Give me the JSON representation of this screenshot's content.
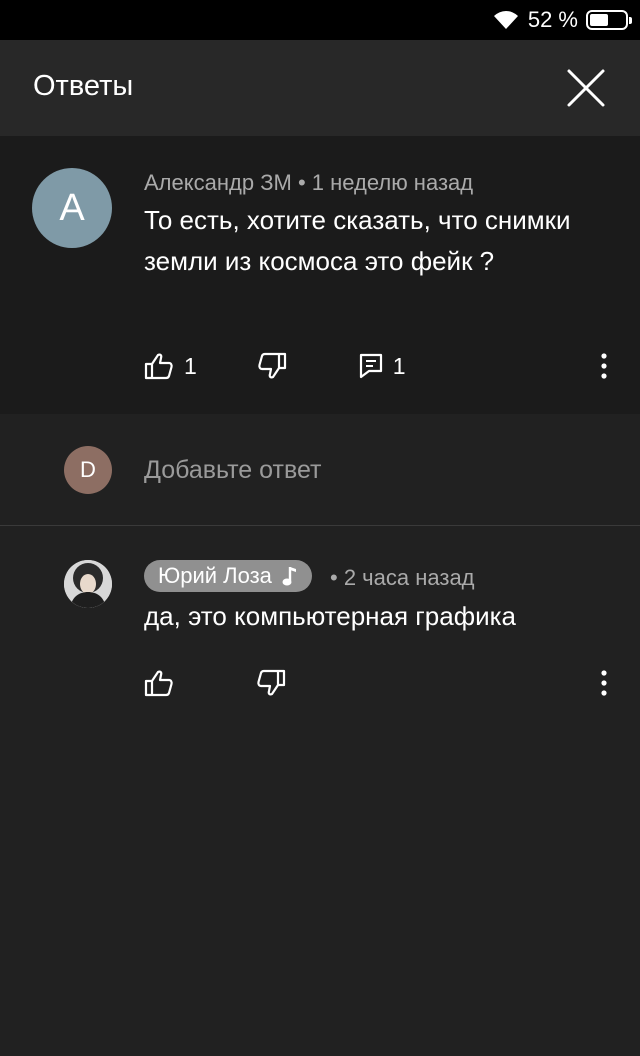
{
  "status_bar": {
    "battery_percent_text": "52 %",
    "battery_level": 0.52,
    "wifi_icon": "wifi-icon"
  },
  "header": {
    "title": "Ответы",
    "close_icon": "close-icon"
  },
  "comment": {
    "avatar_letter": "A",
    "avatar_color": "#7f9aa7",
    "author": "Александр ЗМ",
    "separator": "•",
    "time": "1 неделю назад",
    "text": "То есть, хотите сказать, что снимки земли из космоса это фейк ?",
    "likes": "1",
    "replies": "1"
  },
  "add_reply": {
    "avatar_letter": "D",
    "avatar_color": "#8d6e63",
    "placeholder": "Добавьте ответ"
  },
  "reply": {
    "author": "Юрий Лоза",
    "author_badge_icon": "music-note-icon",
    "separator": "•",
    "time": "2 часа назад",
    "text": "да, это компьютерная графика"
  },
  "colors": {
    "background": "#212121",
    "header": "#282828",
    "highlight": "#1b1b1b",
    "meta": "#aaaaaa"
  }
}
